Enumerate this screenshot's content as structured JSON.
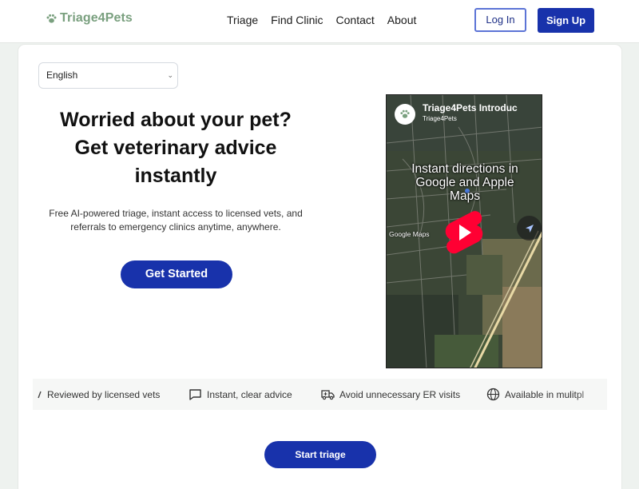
{
  "header": {
    "logo_text": "Triage4Pets",
    "nav": [
      "Triage",
      "Find Clinic",
      "Contact",
      "About"
    ],
    "login_label": "Log In",
    "signup_label": "Sign Up"
  },
  "language": {
    "selected": "English"
  },
  "hero": {
    "title_lines": [
      "Worried about your pet?",
      "Get veterinary advice",
      "instantly"
    ],
    "subtitle_lines": [
      "Free AI-powered triage, instant access to licensed vets, and",
      "referrals to emergency clinics anytime, anywhere."
    ],
    "cta_label": "Get Started"
  },
  "video": {
    "title": "Triage4Pets Introduc",
    "channel": "Triage4Pets",
    "overlay_lines": [
      "Instant directions in",
      "Google and Apple",
      "Maps"
    ],
    "map_credit": "Google Maps",
    "icons": [
      "play-icon",
      "navigation-arrow-icon"
    ]
  },
  "features": [
    {
      "icon": "check-badge-icon",
      "label": "Reviewed by licensed vets"
    },
    {
      "icon": "chat-bubble-icon",
      "label": "Instant, clear advice"
    },
    {
      "icon": "ambulance-icon",
      "label": "Avoid unnecessary ER visits"
    },
    {
      "icon": "globe-icon",
      "label": "Available in mulitpl"
    }
  ],
  "triage_button_label": "Start triage",
  "colors": {
    "brand_blue": "#1832ab",
    "logo_green": "#7aa07f",
    "youtube_red": "#ff0033"
  }
}
